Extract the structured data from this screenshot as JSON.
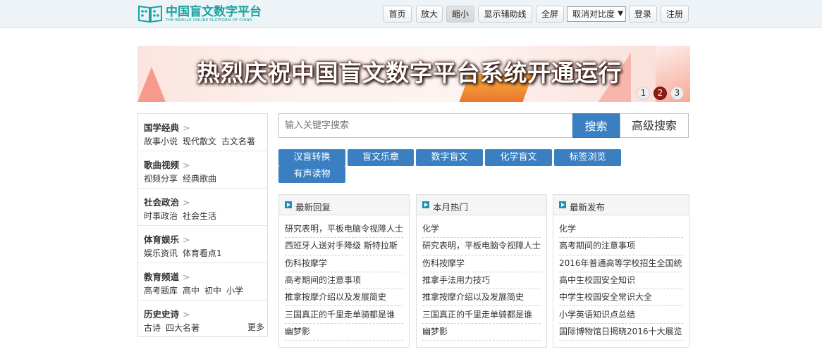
{
  "logo": {
    "title": "中国盲文数字平台",
    "subtitle": "THE BRAILLE ONLINE PLATFORM OF CHINA"
  },
  "toolbar": {
    "home": "首页",
    "zoom_in": "放大",
    "zoom_out": "缩小",
    "guides": "显示辅助线",
    "fullscreen": "全屏",
    "contrast": "取消对比度",
    "login": "登录",
    "register": "注册"
  },
  "banner": {
    "headline": "热烈庆祝中国盲文数字平台系统开通运行",
    "dots": [
      "1",
      "2",
      "3"
    ],
    "active_dot": 2
  },
  "sidebar": {
    "categories": [
      {
        "title": "国学经典",
        "links": [
          "故事小说",
          "现代散文",
          "古文名著"
        ]
      },
      {
        "title": "歌曲视频",
        "links": [
          "视频分享",
          "经典歌曲"
        ]
      },
      {
        "title": "社会政治",
        "links": [
          "时事政治",
          "社会生活"
        ]
      },
      {
        "title": "体育娱乐",
        "links": [
          "娱乐资讯",
          "体育看点1"
        ]
      },
      {
        "title": "教育频道",
        "links": [
          "高考题库",
          "高中",
          "初中",
          "小学"
        ]
      },
      {
        "title": "历史史诗",
        "links": [
          "古诗",
          "四大名著"
        ]
      }
    ],
    "more": "更多"
  },
  "search": {
    "placeholder": "输入关键字搜索",
    "button": "搜索",
    "advanced": "高级搜索"
  },
  "categories": [
    "汉盲转换",
    "盲文乐章",
    "数字盲文",
    "化学盲文",
    "标签浏览",
    "有声读物"
  ],
  "panels": [
    {
      "title": "最新回复",
      "items": [
        "研究表明，平板电脑令视障人士",
        "西班牙人送对手降级 斯特拉斯",
        "伤科按摩学",
        "高考期间的注意事项",
        "推拿按摩介绍以及发展简史",
        "三国真正的千里走单骑都是谁",
        "幽梦影"
      ]
    },
    {
      "title": "本月热门",
      "items": [
        "化学",
        "研究表明，平板电脑令视障人士",
        "伤科按摩学",
        "推拿手法用力技巧",
        "推拿按摩介绍以及发展简史",
        "三国真正的千里走单骑都是谁",
        "幽梦影"
      ]
    },
    {
      "title": "最新发布",
      "items": [
        "化学",
        "高考期间的注意事项",
        "2016年普通高等学校招生全国统",
        "高中生校园安全知识",
        "中学生校园安全常识大全",
        "小学英语知识点总结",
        "国际博物馆日揭晓2016十大展览"
      ]
    }
  ],
  "colors": {
    "primary": "#3a7fc1",
    "logo": "#19a3a0",
    "active_dot": "#8e1a10"
  }
}
